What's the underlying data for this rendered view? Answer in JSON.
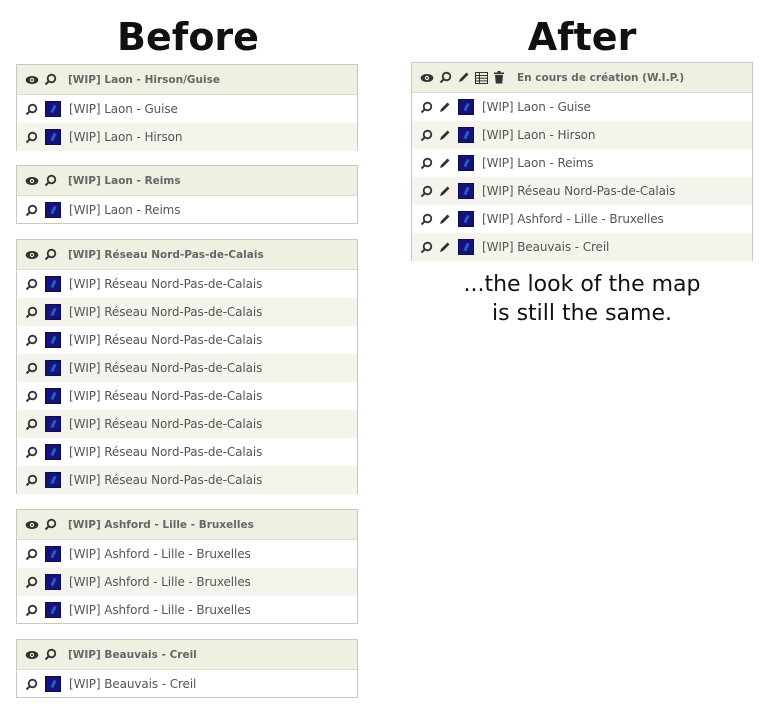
{
  "before": {
    "heading": "Before",
    "groups": [
      {
        "title": "[WIP] Laon - Hirson/Guise",
        "items": [
          "[WIP] Laon - Guise",
          "[WIP] Laon - Hirson"
        ]
      },
      {
        "title": "[WIP] Laon - Reims",
        "items": [
          "[WIP] Laon - Reims"
        ]
      },
      {
        "title": "[WIP] Réseau Nord-Pas-de-Calais",
        "items": [
          "[WIP] Réseau Nord-Pas-de-Calais",
          "[WIP] Réseau Nord-Pas-de-Calais",
          "[WIP] Réseau Nord-Pas-de-Calais",
          "[WIP] Réseau Nord-Pas-de-Calais",
          "[WIP] Réseau Nord-Pas-de-Calais",
          "[WIP] Réseau Nord-Pas-de-Calais",
          "[WIP] Réseau Nord-Pas-de-Calais",
          "[WIP] Réseau Nord-Pas-de-Calais"
        ]
      },
      {
        "title": "[WIP] Ashford - Lille - Bruxelles",
        "items": [
          "[WIP] Ashford - Lille - Bruxelles",
          "[WIP] Ashford - Lille - Bruxelles",
          "[WIP] Ashford - Lille - Bruxelles"
        ]
      },
      {
        "title": "[WIP] Beauvais - Creil",
        "items": [
          "[WIP] Beauvais - Creil"
        ]
      }
    ]
  },
  "after": {
    "heading": "After",
    "group": {
      "title": "En cours de création (W.I.P.)",
      "items": [
        "[WIP] Laon - Guise",
        "[WIP] Laon - Hirson",
        "[WIP] Laon - Reims",
        "[WIP] Réseau Nord-Pas-de-Calais",
        "[WIP] Ashford - Lille - Bruxelles",
        "[WIP] Beauvais - Creil"
      ]
    }
  },
  "caption": {
    "line1": "...the look of the map",
    "line2": "is still the same."
  },
  "icons": {
    "visibility": "eye-icon",
    "zoom": "zoom-icon",
    "edit": "pencil-icon",
    "table": "table-icon",
    "delete": "trash-icon",
    "layer_swatch": "layer-symbol-icon"
  },
  "colors": {
    "header_bg": "#efefe2",
    "row_alt_bg": "#f4f4ec",
    "border": "#c9c9c0",
    "swatch": "#141478"
  }
}
